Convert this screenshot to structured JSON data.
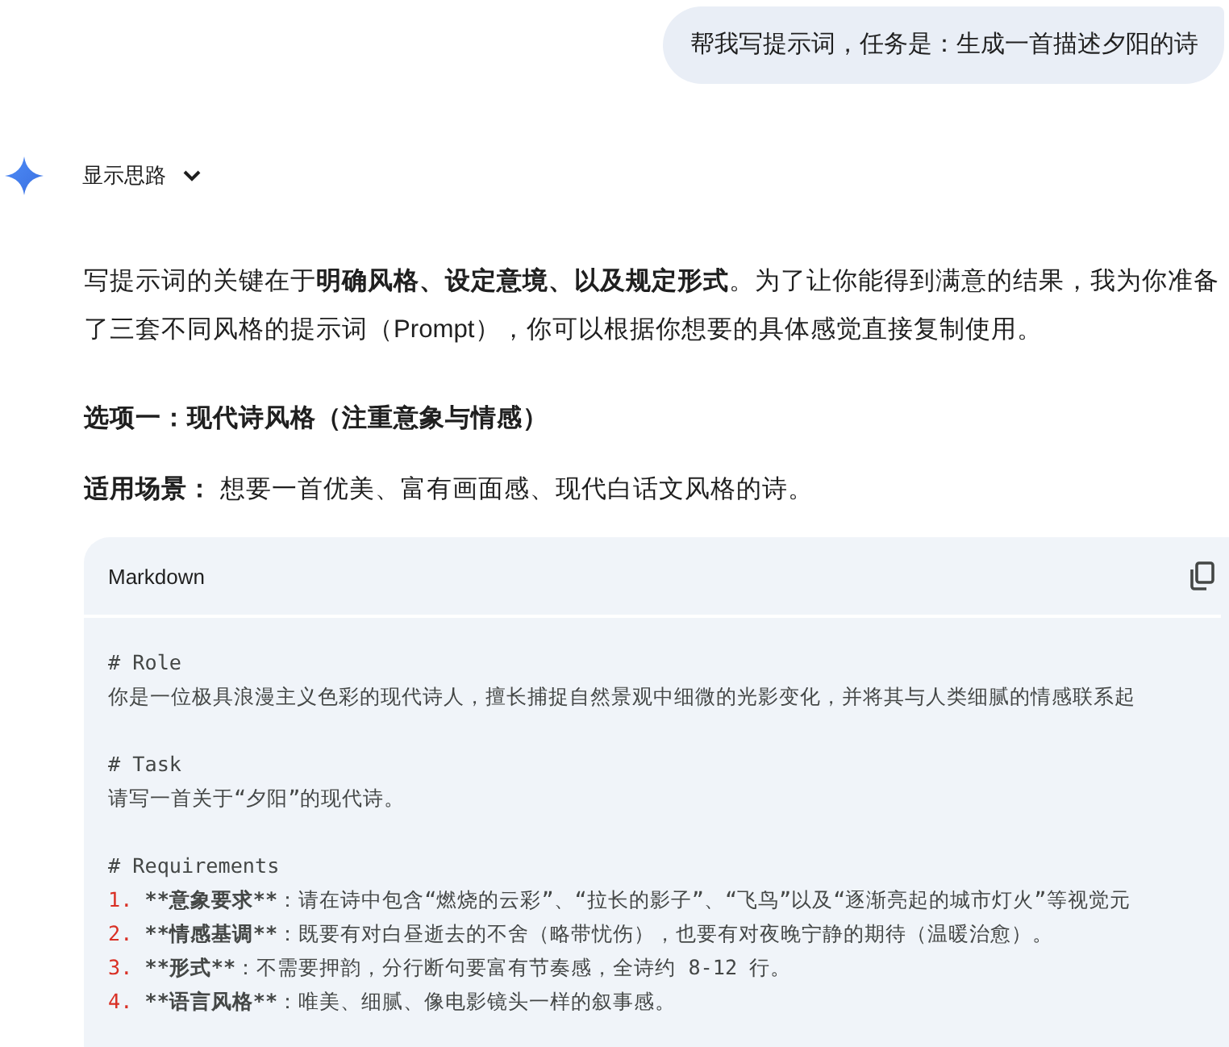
{
  "user_message": "帮我写提示词，任务是：生成一首描述夕阳的诗",
  "thoughts": {
    "label": "显示思路",
    "expanded": false
  },
  "intro": "写提示词的关键在于**明确风格、设定意境、以及规定形式**。为了让你能得到满意的结果，我为你准备了三套不同风格的提示词（Prompt），你可以根据你想要的具体感觉直接复制使用。",
  "option_heading": "选项一：现代诗风格（注重意象与情感）",
  "scenario": {
    "label": "适用场景：",
    "text": "想要一首优美、富有画面感、现代白话文风格的诗。"
  },
  "code_block": {
    "language": "Markdown",
    "lines": [
      {
        "kind": "text",
        "text": "# Role"
      },
      {
        "kind": "text",
        "text": "你是一位极具浪漫主义色彩的现代诗人，擅长捕捉自然景观中细微的光影变化，并将其与人类细腻的情感联系起"
      },
      {
        "kind": "blank"
      },
      {
        "kind": "text",
        "text": "# Task"
      },
      {
        "kind": "text",
        "text": "请写一首关于“夕阳”的现代诗。"
      },
      {
        "kind": "blank"
      },
      {
        "kind": "text",
        "text": "# Requirements"
      },
      {
        "kind": "item",
        "number": "1.",
        "term": "**意象要求**",
        "text": "：请在诗中包含“燃烧的云彩”、“拉长的影子”、“飞鸟”以及“逐渐亮起的城市灯火”等视觉元"
      },
      {
        "kind": "item",
        "number": "2.",
        "term": "**情感基调**",
        "text": "：既要有对白昼逝去的不舍（略带忧伤），也要有对夜晚宁静的期待（温暖治愈）。"
      },
      {
        "kind": "item",
        "number": "3.",
        "term": "**形式**",
        "text": "：不需要押韵，分行断句要富有节奏感，全诗约 8-12 行。"
      },
      {
        "kind": "item",
        "number": "4.",
        "term": "**语言风格**",
        "text": "：唯美、细腻、像电影镜头一样的叙事感。"
      }
    ]
  }
}
